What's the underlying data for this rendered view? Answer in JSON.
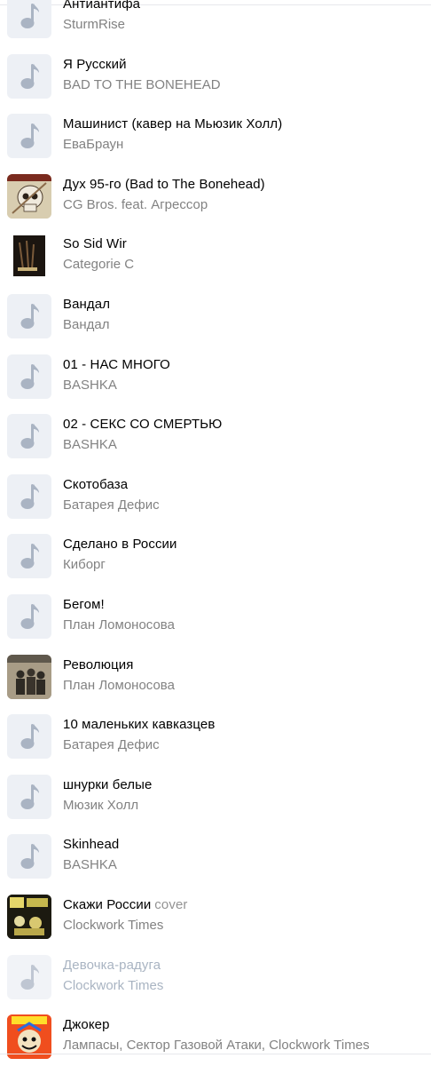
{
  "tracks": [
    {
      "title": "Антиантифа",
      "subtitle": "",
      "artist": "SturmRise",
      "cover": "placeholder"
    },
    {
      "title": "Я Русский",
      "subtitle": "",
      "artist": "BAD TO THE BONEHEAD",
      "cover": "placeholder"
    },
    {
      "title": "Машинист (кавер на Мьюзик Холл)",
      "subtitle": "",
      "artist": "ЕваБраун",
      "cover": "placeholder"
    },
    {
      "title": "Дух 95-го (Bad to The Bonehead)",
      "subtitle": "",
      "artist": "CG Bros. feat. Агрессор",
      "cover": "skull-art"
    },
    {
      "title": "So Sid Wir",
      "subtitle": "",
      "artist": "Categorie C",
      "cover": "dark-art"
    },
    {
      "title": "Вандал",
      "subtitle": "",
      "artist": "Вандал",
      "cover": "placeholder"
    },
    {
      "title": "01 - НАС МНОГО",
      "subtitle": "",
      "artist": "BASHKA",
      "cover": "placeholder"
    },
    {
      "title": "02 - СЕКС СО СМЕРТЬЮ",
      "subtitle": "",
      "artist": "BASHKA",
      "cover": "placeholder"
    },
    {
      "title": "Скотобаза",
      "subtitle": "",
      "artist": "Батарея Дефис",
      "cover": "placeholder"
    },
    {
      "title": "Сделано в России",
      "subtitle": "",
      "artist": "Киборг",
      "cover": "placeholder"
    },
    {
      "title": "Бегом!",
      "subtitle": "",
      "artist": "План Ломоносова",
      "cover": "placeholder"
    },
    {
      "title": "Революция",
      "subtitle": "",
      "artist": "План Ломоносова",
      "cover": "band-photo"
    },
    {
      "title": "10 маленьких кавказцев",
      "subtitle": "",
      "artist": "Батарея Дефис",
      "cover": "placeholder"
    },
    {
      "title": "шнурки белые",
      "subtitle": "",
      "artist": "Мюзик Холл",
      "cover": "placeholder"
    },
    {
      "title": "Skinhead",
      "subtitle": "",
      "artist": "BASHKA",
      "cover": "placeholder"
    },
    {
      "title": "Скажи России",
      "subtitle": "cover",
      "artist": "Clockwork Times",
      "cover": "punk-art"
    },
    {
      "title": "Девочка-радуга",
      "subtitle": "",
      "artist": "Clockwork Times",
      "cover": "placeholder",
      "dimmed": true
    },
    {
      "title": "Джокер",
      "subtitle": "",
      "artist": "Лампасы, Сектор Газовой Атаки, Clockwork Times",
      "cover": "comic-art"
    }
  ]
}
